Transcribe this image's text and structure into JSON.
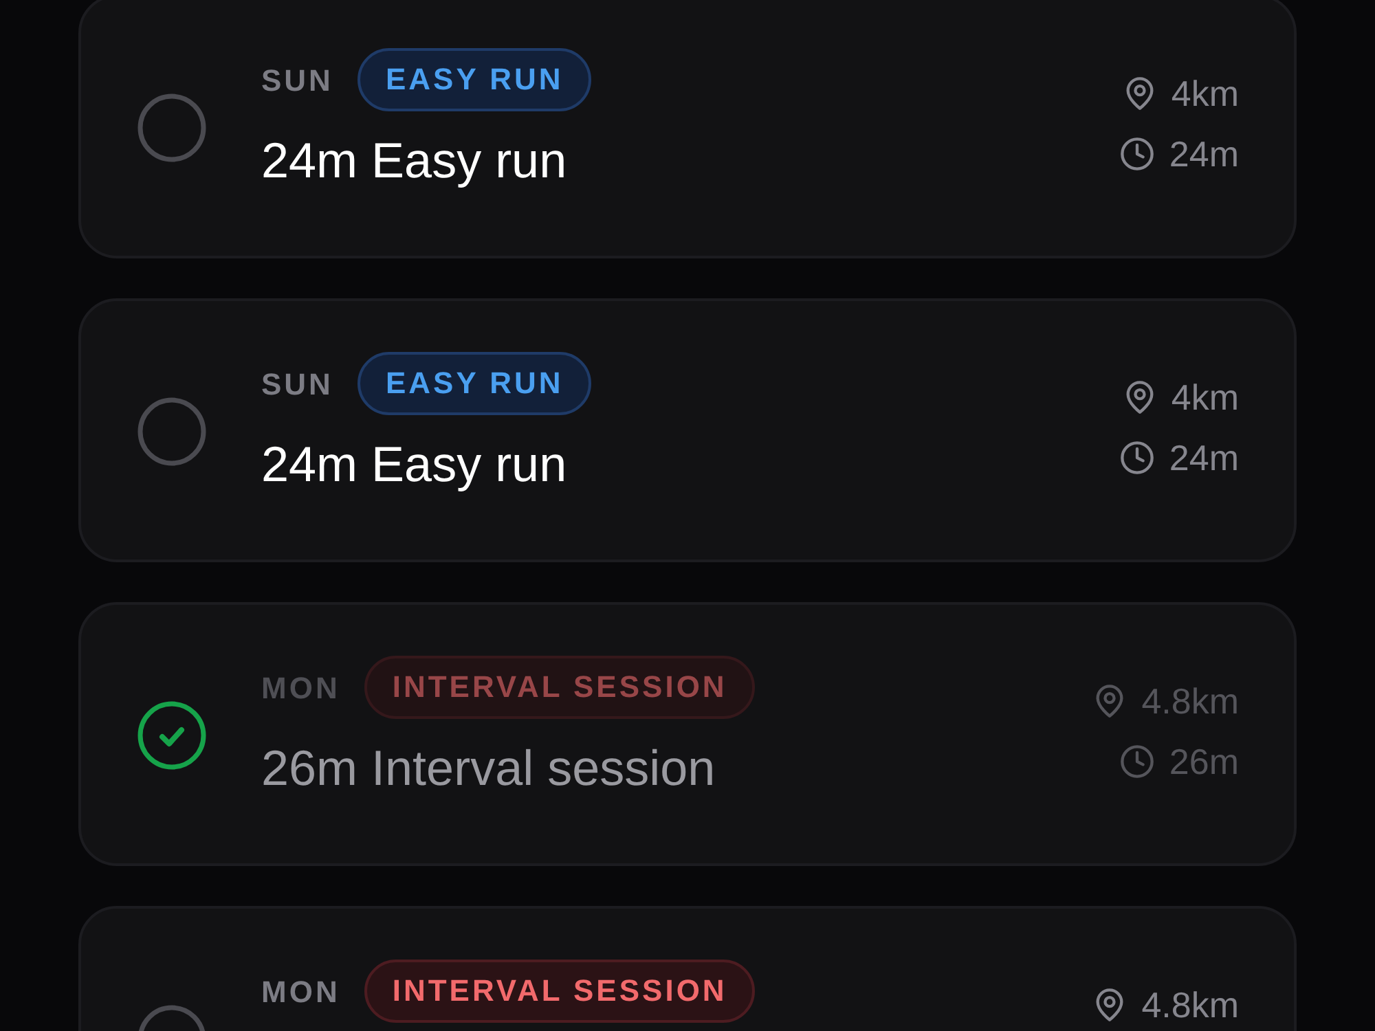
{
  "workouts": [
    {
      "day": "SUN",
      "tag": {
        "label": "EASY RUN",
        "kind": "easy"
      },
      "title": "24m Easy run",
      "distance": "4km",
      "duration": "24m",
      "completed": false
    },
    {
      "day": "SUN",
      "tag": {
        "label": "EASY RUN",
        "kind": "easy"
      },
      "title": "24m Easy run",
      "distance": "4km",
      "duration": "24m",
      "completed": false
    },
    {
      "day": "MON",
      "tag": {
        "label": "INTERVAL SESSION",
        "kind": "interval"
      },
      "title": "26m Interval session",
      "distance": "4.8km",
      "duration": "26m",
      "completed": true
    },
    {
      "day": "MON",
      "tag": {
        "label": "INTERVAL SESSION",
        "kind": "interval"
      },
      "distance": "4.8km",
      "completed": false
    }
  ]
}
